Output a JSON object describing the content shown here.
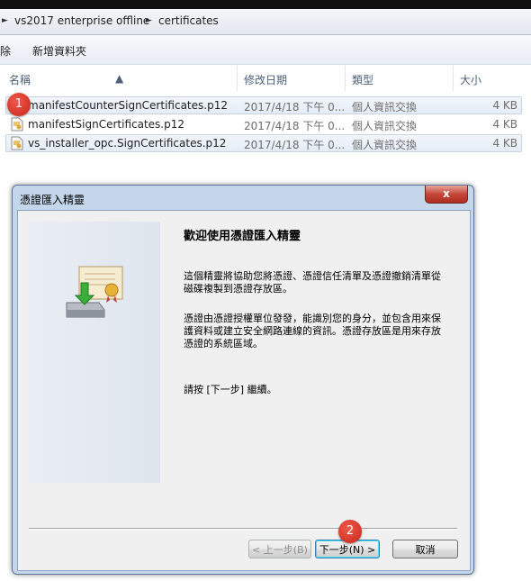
{
  "breadcrumb": {
    "items": [
      "vs2017 enterprise offline",
      "certificates"
    ]
  },
  "toolbar": {
    "left_partial": "除",
    "new_folder": "新增資料夾"
  },
  "columns": {
    "name": "名稱",
    "date": "修改日期",
    "type": "類型",
    "size": "大小"
  },
  "files": [
    {
      "name": "manifestCounterSignCertificates.p12",
      "date": "2017/4/18 下午 0...",
      "type": "個人資訊交換",
      "size": "4 KB"
    },
    {
      "name": "manifestSignCertificates.p12",
      "date": "2017/4/18 下午 0...",
      "type": "個人資訊交換",
      "size": "4 KB"
    },
    {
      "name": "vs_installer_opc.SignCertificates.p12",
      "date": "2017/4/18 下午 0...",
      "type": "個人資訊交換",
      "size": "4 KB"
    }
  ],
  "badges": {
    "one": "1",
    "two": "2"
  },
  "dialog": {
    "title": "憑證匯入精靈",
    "close_glyph": "x",
    "heading": "歡迎使用憑證匯入精靈",
    "para1": "這個精靈將協助您將憑證、憑證信任清單及憑證撤銷清單從磁碟複製到憑證存放區。",
    "para2": "憑證由憑證授權單位發發，能識別您的身分，並包含用來保護資料或建立安全網路連線的資訊。憑證存放區是用來存放憑證的系統區域。",
    "para3": "請按 [下一步] 繼續。",
    "back_btn": "< 上一步(B)",
    "next_btn": "下一步(N) >",
    "cancel_btn": "取消"
  },
  "colors": {
    "badge": "#d32f22",
    "selection": "#e4ecf6",
    "dialog_frame": "#c4d6ea"
  }
}
